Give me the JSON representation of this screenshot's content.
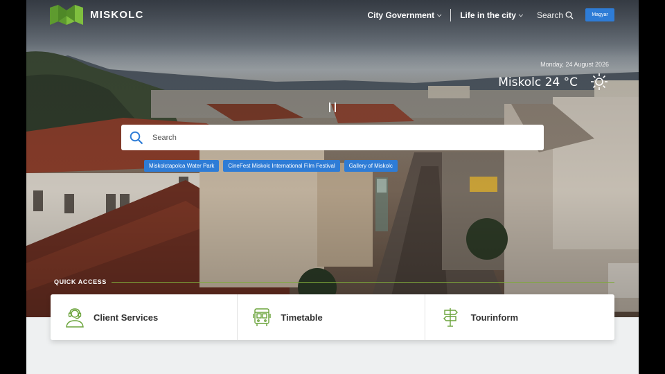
{
  "header": {
    "logo_text": "MISKOLC",
    "nav": {
      "city_government": "City Government",
      "life_in_city": "Life in the city",
      "search": "Search",
      "language": "Magyar"
    }
  },
  "weather": {
    "date": "Monday, 24 August 2026",
    "city_temp": "Miskolc 24 °C",
    "icon": "sun-icon"
  },
  "search": {
    "placeholder": "Search"
  },
  "tags": [
    "Miskolctapolca Water Park",
    "CineFest Miskolc International Film Festival",
    "Gallery of Miskolc"
  ],
  "quick_access": {
    "title": "QUICK ACCESS",
    "items": [
      {
        "label": "Client Services",
        "icon": "headset-person-icon"
      },
      {
        "label": "Timetable",
        "icon": "bus-icon"
      },
      {
        "label": "Tourinform",
        "icon": "signpost-icon"
      }
    ]
  },
  "colors": {
    "accent_blue": "#2e7cd6",
    "accent_green": "#7ea93a",
    "icon_green": "#6aa33a"
  }
}
